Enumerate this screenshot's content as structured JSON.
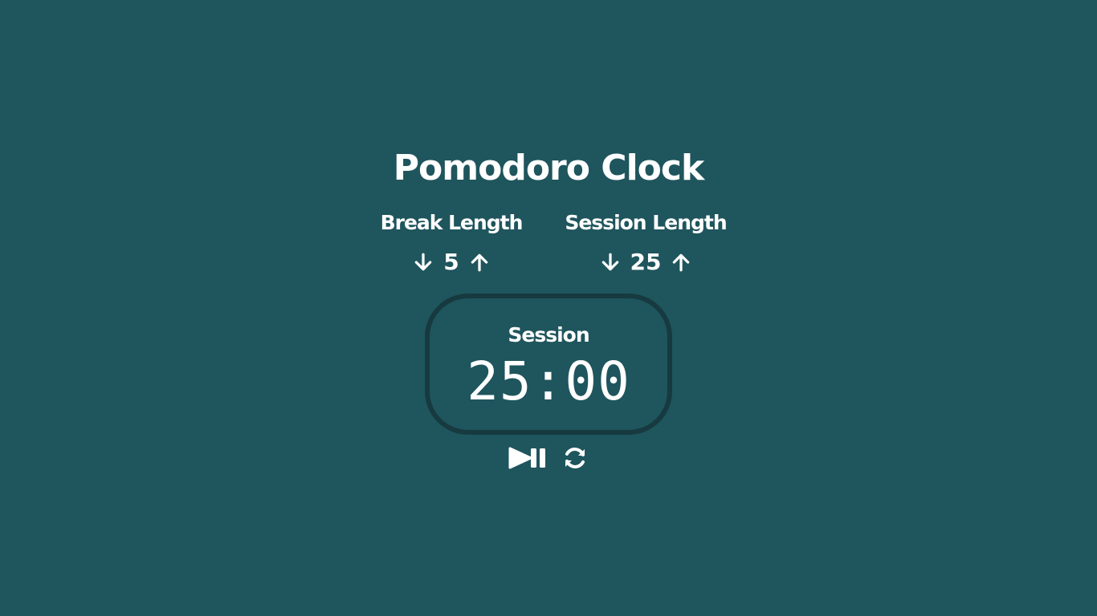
{
  "app": {
    "title": "Pomodoro Clock"
  },
  "break_length": {
    "label": "Break Length",
    "value": "5",
    "decrement_icon": "arrow-down-icon",
    "increment_icon": "arrow-up-icon"
  },
  "session_length": {
    "label": "Session Length",
    "value": "25",
    "decrement_icon": "arrow-down-icon",
    "increment_icon": "arrow-up-icon"
  },
  "timer": {
    "label": "Session",
    "display": "25:00"
  },
  "controls": {
    "play_pause_icon": "play-pause-icon",
    "reset_icon": "refresh-icon"
  },
  "colors": {
    "background": "#1f555d",
    "timer_border": "#163a40",
    "text": "#ffffff"
  }
}
